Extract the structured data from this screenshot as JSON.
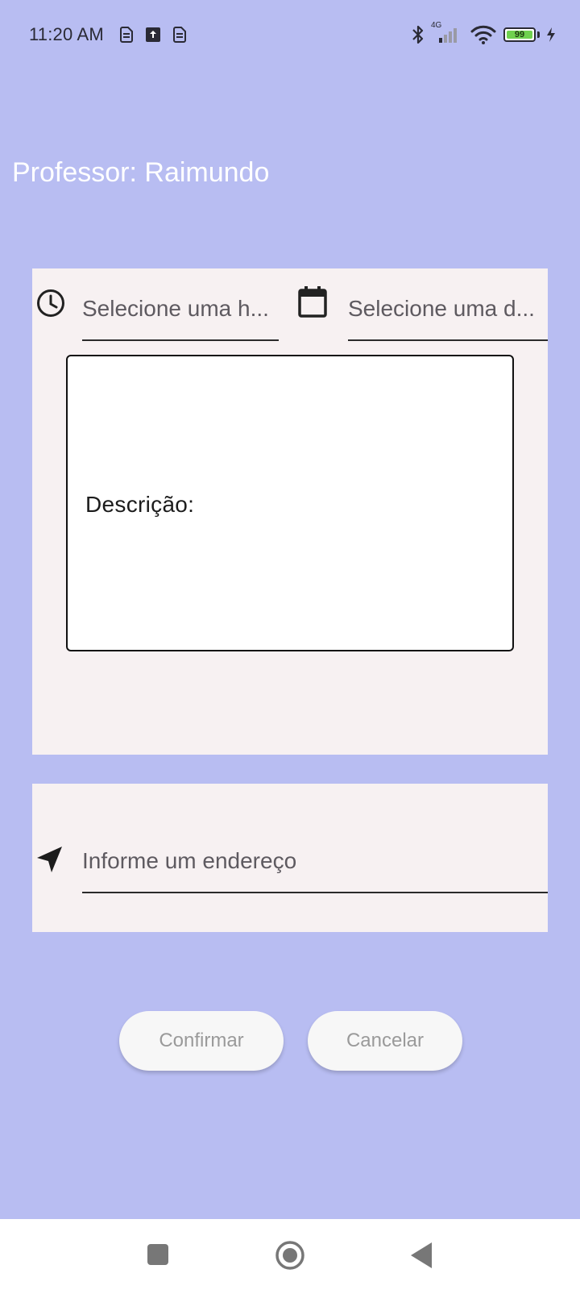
{
  "status_bar": {
    "time": "11:20 AM",
    "left_icons": [
      "sim-card-icon",
      "upload-icon",
      "sim-card-icon"
    ],
    "right_icons": [
      "bluetooth-icon",
      "cellular-4g-icon",
      "wifi-icon",
      "battery-icon",
      "charging-icon"
    ],
    "network_label": "4G",
    "battery_level": "99"
  },
  "header": {
    "title": "Professor: Raimundo"
  },
  "schedule_card": {
    "time_field": {
      "icon": "clock-icon",
      "placeholder": "Selecione uma h..."
    },
    "date_field": {
      "icon": "calendar-icon",
      "placeholder": "Selecione uma d..."
    },
    "description": {
      "label": "Descrição:"
    }
  },
  "address_card": {
    "icon": "navigation-arrow-icon",
    "placeholder": "Informe um endereço"
  },
  "actions": {
    "confirm_label": "Confirmar",
    "cancel_label": "Cancelar"
  },
  "nav_bar": {
    "items": [
      "recents-square-icon",
      "home-circle-icon",
      "back-triangle-icon"
    ]
  },
  "colors": {
    "background": "#b8bdf2",
    "card_background": "#f7f1f2",
    "title_text": "#ffffff",
    "button_background": "#f7f7f7",
    "button_text": "#9a9a9a",
    "battery_fill": "#6fd14f"
  }
}
